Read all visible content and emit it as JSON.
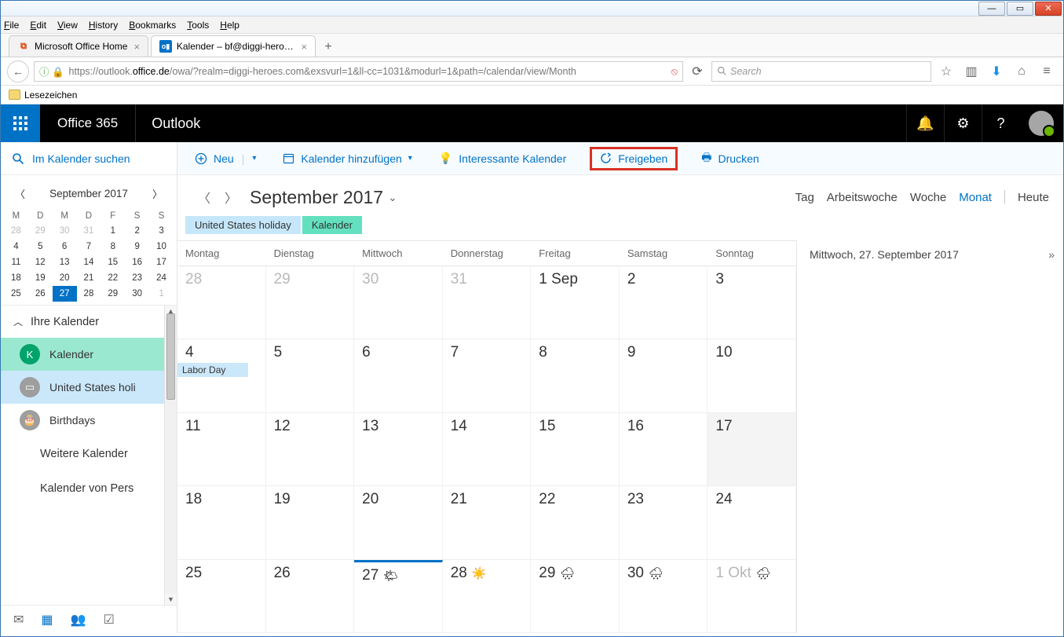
{
  "window": {
    "menus": [
      "File",
      "Edit",
      "View",
      "History",
      "Bookmarks",
      "Tools",
      "Help"
    ],
    "tabs": [
      {
        "label": "Microsoft Office Home",
        "active": false,
        "fav": "office"
      },
      {
        "label": "Kalender – bf@diggi-heroes.",
        "active": true,
        "fav": "outlook"
      }
    ],
    "url_prefix": "https://outlook.",
    "url_domain": "office.de",
    "url_rest": "/owa/?realm=diggi-heroes.com&exsvurl=1&ll-cc=1031&modurl=1&path=/calendar/view/Month",
    "search_placeholder": "Search",
    "bookmark_bar": "Lesezeichen"
  },
  "o365": {
    "brand": "Office 365",
    "app": "Outlook"
  },
  "left": {
    "search": "Im Kalender suchen",
    "mini_title": "September 2017",
    "dow": [
      "M",
      "D",
      "M",
      "D",
      "F",
      "S",
      "S"
    ],
    "rows": [
      [
        {
          "n": "28",
          "f": true
        },
        {
          "n": "29",
          "f": true
        },
        {
          "n": "30",
          "f": true
        },
        {
          "n": "31",
          "f": true
        },
        {
          "n": "1"
        },
        {
          "n": "2"
        },
        {
          "n": "3"
        }
      ],
      [
        {
          "n": "4"
        },
        {
          "n": "5"
        },
        {
          "n": "6"
        },
        {
          "n": "7"
        },
        {
          "n": "8"
        },
        {
          "n": "9"
        },
        {
          "n": "10"
        }
      ],
      [
        {
          "n": "11"
        },
        {
          "n": "12"
        },
        {
          "n": "13"
        },
        {
          "n": "14"
        },
        {
          "n": "15"
        },
        {
          "n": "16"
        },
        {
          "n": "17"
        }
      ],
      [
        {
          "n": "18"
        },
        {
          "n": "19"
        },
        {
          "n": "20"
        },
        {
          "n": "21"
        },
        {
          "n": "22"
        },
        {
          "n": "23"
        },
        {
          "n": "24"
        }
      ],
      [
        {
          "n": "25"
        },
        {
          "n": "26"
        },
        {
          "n": "27",
          "today": true
        },
        {
          "n": "28"
        },
        {
          "n": "29"
        },
        {
          "n": "30"
        },
        {
          "n": "1",
          "f": true
        }
      ]
    ],
    "group": "Ihre Kalender",
    "cals": [
      {
        "name": "Kalender",
        "cls": "green",
        "badge": "K"
      },
      {
        "name": "United States holi",
        "cls": "blue",
        "badge": "▭"
      },
      {
        "name": "Birthdays",
        "cls": "",
        "badge": "🎂"
      }
    ],
    "more1": "Weitere Kalender",
    "more2": "Kalender von Pers"
  },
  "cmd": {
    "new": "Neu",
    "add": "Kalender hinzufügen",
    "interesting": "Interessante Kalender",
    "share": "Freigeben",
    "print": "Drucken"
  },
  "header": {
    "month": "September 2017",
    "views": [
      "Tag",
      "Arbeitswoche",
      "Woche",
      "Monat"
    ],
    "active_view": "Monat",
    "today": "Heute",
    "tabs": [
      {
        "t": "United States holiday",
        "c": "blue"
      },
      {
        "t": "Kalender",
        "c": "green"
      }
    ]
  },
  "grid": {
    "dow": [
      "Montag",
      "Dienstag",
      "Mittwoch",
      "Donnerstag",
      "Freitag",
      "Samstag",
      "Sonntag"
    ],
    "weeks": [
      [
        {
          "n": "28",
          "faded": true
        },
        {
          "n": "29",
          "faded": true
        },
        {
          "n": "30",
          "faded": true
        },
        {
          "n": "31",
          "faded": true
        },
        {
          "n": "1 Sep"
        },
        {
          "n": "2"
        },
        {
          "n": "3"
        }
      ],
      [
        {
          "n": "4",
          "event": "Labor Day"
        },
        {
          "n": "5"
        },
        {
          "n": "6"
        },
        {
          "n": "7"
        },
        {
          "n": "8"
        },
        {
          "n": "9"
        },
        {
          "n": "10"
        }
      ],
      [
        {
          "n": "11"
        },
        {
          "n": "12"
        },
        {
          "n": "13"
        },
        {
          "n": "14"
        },
        {
          "n": "15"
        },
        {
          "n": "16"
        },
        {
          "n": "17",
          "grey": true
        }
      ],
      [
        {
          "n": "18"
        },
        {
          "n": "19"
        },
        {
          "n": "20"
        },
        {
          "n": "21"
        },
        {
          "n": "22"
        },
        {
          "n": "23"
        },
        {
          "n": "24"
        }
      ],
      [
        {
          "n": "25"
        },
        {
          "n": "26"
        },
        {
          "n": "27",
          "today": true,
          "weather": "🌤"
        },
        {
          "n": "28",
          "weather": "☀️"
        },
        {
          "n": "29",
          "weather": "🌧"
        },
        {
          "n": "30",
          "weather": "🌧"
        },
        {
          "n": "1 Okt",
          "faded": true,
          "weather": "🌧"
        }
      ]
    ]
  },
  "rightpane": {
    "date": "Mittwoch, 27. September 2017"
  }
}
